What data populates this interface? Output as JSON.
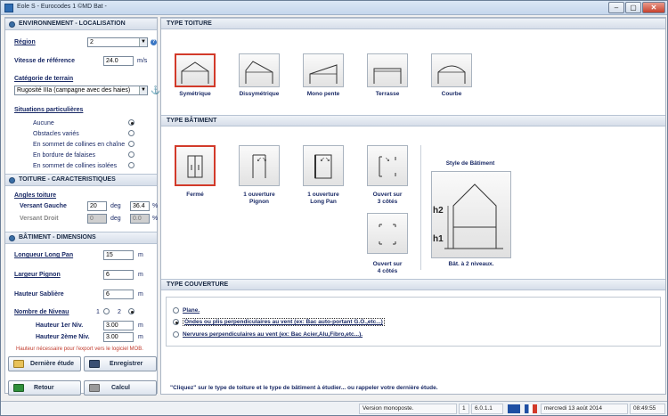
{
  "window": {
    "title": "Eole S - Eurocodes 1 ©MD Bat -",
    "buttons": [
      "–",
      "▢",
      "✕"
    ]
  },
  "left": {
    "env": {
      "title": "ENVIRONNEMENT - LOCALISATION",
      "region_label": "Région",
      "region_value": "2",
      "vitesse_label": "Vitesse de référence",
      "vitesse_value": "24.0",
      "vitesse_unit": "m/s",
      "categorie_label": "Catégorie de terrain",
      "categorie_value": "Rugosité IIIa (campagne avec des haies)",
      "situations_label": "Situations particulières",
      "situations": [
        "Aucune",
        "Obstacles variés",
        "En sommet de collines en chaîne",
        "En bordure de falaises",
        "En sommet de collines isolées"
      ]
    },
    "toiture": {
      "title": "TOITURE - CARACTERISTIQUES",
      "angles_label": "Angles toiture",
      "gauche_label": "Versant Gauche",
      "gauche_deg": "20",
      "gauche_pct": "36.4",
      "droit_label": "Versant Droit",
      "droit_deg": "0",
      "droit_pct": "0.0",
      "deg": "deg",
      "pct": "%"
    },
    "batiment": {
      "title": "BÂTIMENT - DIMENSIONS",
      "long_pan_label": "Longueur Long Pan",
      "long_pan_value": "15",
      "pignon_label": "Largeur Pignon",
      "pignon_value": "6",
      "sabliere_label": "Hauteur Sablière",
      "sabliere_value": "6",
      "niveau_label": "Nombre de Niveau",
      "niveau_opts": [
        "1",
        "2"
      ],
      "h1_label": "Hauteur 1er Niv.",
      "h1_value": "3.00",
      "h2_label": "Hauteur 2ème Niv.",
      "h2_value": "3.00",
      "unit": "m",
      "note": "Hauteur nécessaire pour l'export vers le logiciel MOB."
    },
    "buttons": {
      "derniere": "Dernière étude",
      "enregistrer": "Enregistrer",
      "retour": "Retour",
      "calcul": "Calcul"
    }
  },
  "right": {
    "toiture_title": "TYPE TOITURE",
    "toitures": [
      "Symétrique",
      "Dissymétrique",
      "Mono pente",
      "Terrasse",
      "Courbe"
    ],
    "batiment_title": "TYPE BÂTIMENT",
    "batiments": [
      [
        "Fermé"
      ],
      [
        "1 ouverture",
        "Pignon"
      ],
      [
        "1 ouverture",
        "Long Pan"
      ],
      [
        "Ouvert sur",
        "3 côtés"
      ],
      [
        "Ouvert sur",
        "4 côtés"
      ]
    ],
    "style_title": "Style de Bâtiment",
    "style_labels": {
      "h2": "h2",
      "h1": "h1"
    },
    "style_caption": "Bât. à 2 niveaux.",
    "couverture_title": "TYPE COUVERTURE",
    "couvertures": [
      "Plane.",
      "Ondes ou plis perpendiculaires au vent (ex: Bac auto-portant G.O.,etc...)",
      "Nervures perpendiculaires au vent (ex: Bac Acier,Alu,Fibro,etc...)."
    ],
    "hint": "\"Cliquez\" sur le type de toiture et le type de bâtiment à étudier...  ou  rappeler votre dernière étude."
  },
  "status": {
    "version": "Version monoposte.",
    "num": "1",
    "ver": "6.0.1.1",
    "date": "mercredi 13  août  2014",
    "time": "08:49:55"
  }
}
